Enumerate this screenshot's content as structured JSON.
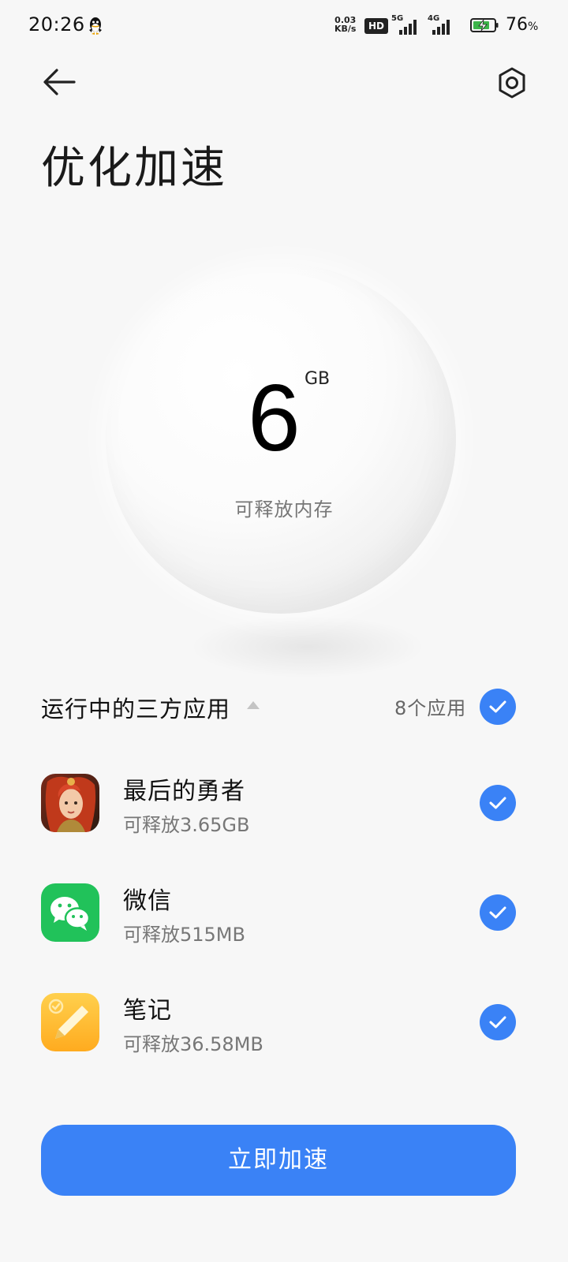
{
  "status_bar": {
    "time": "20:26",
    "net_speed_value": "0.03",
    "net_speed_unit": "KB/s",
    "hd_badge": "HD",
    "signal_1_label": "5G",
    "signal_2_label": "4G",
    "battery_percent": "76",
    "battery_unit": "%"
  },
  "header": {
    "title": "优化加速"
  },
  "memory": {
    "value": "6",
    "unit": "GB",
    "label": "可释放内存"
  },
  "section": {
    "title": "运行中的三方应用",
    "app_count": "8个应用"
  },
  "apps": [
    {
      "name": "最后的勇者",
      "size": "可释放3.65GB",
      "icon": "game-hero-icon",
      "checked": true
    },
    {
      "name": "微信",
      "size": "可释放515MB",
      "icon": "wechat-icon",
      "checked": true
    },
    {
      "name": "笔记",
      "size": "可释放36.58MB",
      "icon": "notes-icon",
      "checked": true
    }
  ],
  "actions": {
    "boost_label": "立即加速"
  },
  "colors": {
    "accent": "#3a82f6",
    "background": "#f7f7f7",
    "wechat_green": "#21c25a",
    "notes_yellow": "#ffc53a"
  }
}
